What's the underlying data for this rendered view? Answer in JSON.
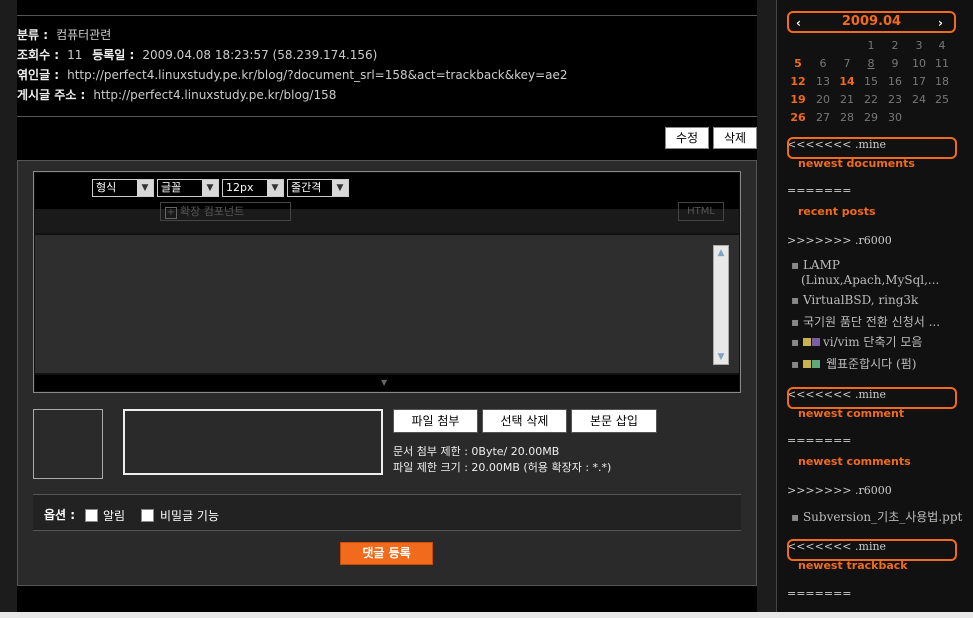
{
  "post_meta": {
    "category_label": "분류 :",
    "category_value": "컴퓨터관련",
    "views_label": "조회수 :",
    "views_value": "11",
    "date_label": "등록일 :",
    "date_value": "2009.04.08 18:23:57 (58.239.174.156)",
    "trackback_label": "엮인글 :",
    "trackback_value": "http://perfect4.linuxstudy.pe.kr/blog/?document_srl=158&act=trackback&key=ae2",
    "address_label": "게시글 주소 :",
    "address_value": "http://perfect4.linuxstudy.pe.kr/blog/158"
  },
  "actions": {
    "edit": "수정",
    "delete": "삭제"
  },
  "editor": {
    "selects": [
      "형식",
      "글꼴",
      "12px",
      "줄간격"
    ],
    "extension_button": "확장 컴포넌트",
    "html_button": "HTML"
  },
  "attachments": {
    "attach_button": "파일 첨부",
    "delete_selected_button": "선택 삭제",
    "insert_button": "본문 삽입",
    "limit_note": "문서 첨부 제한 : 0Byte/ 20.00MB",
    "size_note": "파일 제한 크기 : 20.00MB (허용 확장자 : *.*)"
  },
  "options": {
    "label": "옵션 :",
    "notify": "알림",
    "secret": "비밀글 기능"
  },
  "submit": "댓글 등록",
  "sidebar": {
    "calendar": {
      "prev": "‹",
      "next": "›",
      "month": "2009.04",
      "weeks": [
        [
          "",
          "",
          "",
          "1",
          "2",
          "3",
          "4"
        ],
        [
          "5",
          "6",
          "7",
          "8",
          "9",
          "10",
          "11"
        ],
        [
          "12",
          "13",
          "14",
          "15",
          "16",
          "17",
          "18"
        ],
        [
          "19",
          "20",
          "21",
          "22",
          "23",
          "24",
          "25"
        ],
        [
          "26",
          "27",
          "28",
          "29",
          "30",
          "",
          ""
        ]
      ]
    },
    "mine_marker_1": "<<<<<<< .mine",
    "newest_documents": "newest documents",
    "sep_1": "=======",
    "recent_posts": "recent posts",
    "r6000_marker_1": ">>>>>>> .r6000",
    "posts": [
      "LAMP",
      "(Linux,Apach,MySql,...",
      "VirtualBSD, ring3k",
      "국기원 품단 전환 신청서 ...",
      "vi/vim 단축기 모음",
      "웹표준합시다 (펌)"
    ],
    "mine_marker_2": "<<<<<<< .mine",
    "newest_comment": "newest comment",
    "sep_2": "=======",
    "newest_comments": "newest comments",
    "r6000_marker_2": ">>>>>>> .r6000",
    "comments": [
      "Subversion_기초_사용법.ppt"
    ],
    "mine_marker_3": "<<<<<<< .mine",
    "newest_trackback": "newest trackback",
    "sep_3": "=======",
    "accent_color": "#f26a1b"
  }
}
